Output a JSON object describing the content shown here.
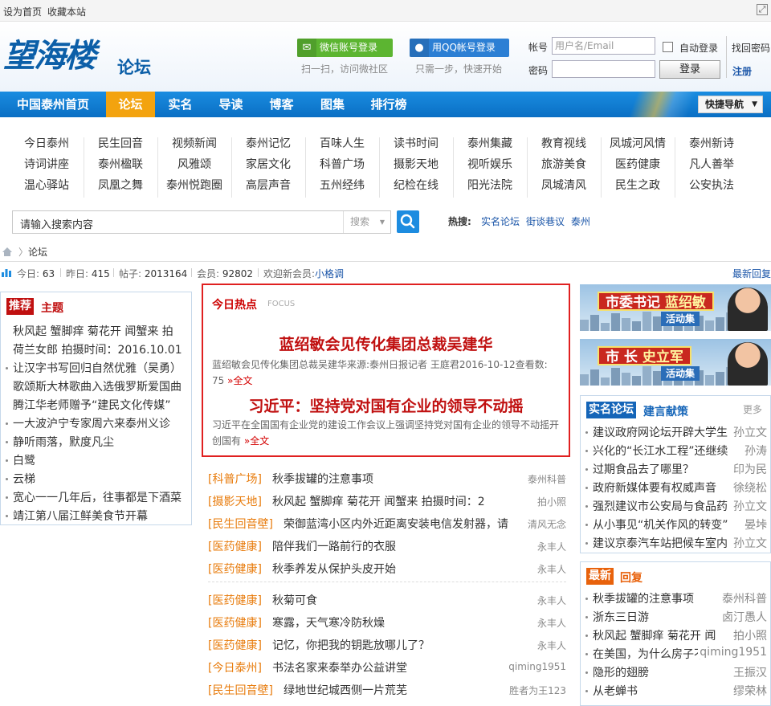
{
  "topbar": {
    "set_home": "设为首页",
    "bookmark": "收藏本站"
  },
  "header": {
    "logo_art": "望海楼",
    "logo_sub": "论坛",
    "wechat_login": "微信账号登录",
    "wechat_tip": "扫一扫，访问微社区",
    "qq_login": "用QQ帐号登录",
    "qq_tip": "只需一步，快速开始",
    "account_label": "帐号",
    "account_placeholder": "用户名/Email",
    "password_label": "密码",
    "auto_login": "自动登录",
    "login_button": "登录",
    "find_password": "找回密码",
    "register": "注册"
  },
  "nav": {
    "items": [
      "中国泰州首页",
      "论坛",
      "实名",
      "导读",
      "博客",
      "图集",
      "排行榜"
    ],
    "active_index": 1,
    "quick_nav": "快捷导航"
  },
  "categories": [
    [
      "今日泰州",
      "诗词讲座",
      "温心驿站"
    ],
    [
      "民生回音",
      "泰州楹联",
      "凤凰之舞"
    ],
    [
      "视频新闻",
      "风雅颂",
      "泰州悦跑圈"
    ],
    [
      "泰州记忆",
      "家居文化",
      "高层声音"
    ],
    [
      "百味人生",
      "科普广场",
      "五州经纬"
    ],
    [
      "读书时间",
      "摄影天地",
      "纪检在线"
    ],
    [
      "泰州集藏",
      "视听娱乐",
      "阳光法院"
    ],
    [
      "教育视线",
      "旅游美食",
      "凤城清风"
    ],
    [
      "凤城河风情",
      "医药健康",
      "民生之政"
    ],
    [
      "泰州新诗",
      "凡人善举",
      "公安执法"
    ]
  ],
  "search": {
    "placeholder": "请输入搜索内容",
    "type_label": "搜索",
    "hot_label": "热搜:",
    "hot_links": [
      "实名论坛",
      "街谈巷议",
      "泰州"
    ]
  },
  "breadcrumb": {
    "current": "论坛"
  },
  "stats": {
    "today_label": "今日:",
    "today": "63",
    "yesterday_label": "昨日:",
    "yesterday": "415",
    "posts_label": "帖子:",
    "posts": "2013164",
    "members_label": "会员:",
    "members": "92802",
    "welcome": "欢迎新会员:",
    "newest_member": "小格调",
    "latest_reply": "最新回复"
  },
  "recommend": {
    "tag": "推荐",
    "title": "主题",
    "items": [
      "秋风起 蟹脚痒 菊花开 闻蟹来 拍",
      "荷兰女郎 拍摄时间：2016.10.01",
      "让汉字书写回归自然优雅（吴勇）",
      "歌颂斯大林歌曲入选俄罗斯爱国曲",
      "腾江华老师赠予“建民文化传媒”",
      "一大波沪宁专家周六来泰州义诊",
      "静听雨落，默度凡尘",
      "白鹭",
      "云梯",
      "宽心一一几年后，往事都是下酒菜",
      "靖江第八届江鲜美食节开幕"
    ],
    "bulleted": [
      false,
      false,
      true,
      false,
      false,
      true,
      true,
      true,
      true,
      true,
      true
    ]
  },
  "focus": {
    "title": "今日热点",
    "subtitle": "FOCUS",
    "headline1": "蓝绍敏会见传化集团总裁吴建华",
    "desc1": "蓝绍敏会见传化集团总裁吴建华来源:泰州日报记者 王庭君2016-10-12查看数: 75",
    "more1": "全文",
    "headline2": "习近平：坚持党对国有企业的领导不动摇",
    "desc2": "习近平在全国国有企业党的建设工作会议上强调坚持党对国有企业的领导不动摇开创国有",
    "more2": "全文"
  },
  "threads": [
    {
      "cat": "[科普广场]",
      "title": "秋季拔罐的注意事项",
      "author": "泰州科普"
    },
    {
      "cat": "[摄影天地]",
      "title": "秋风起 蟹脚痒 菊花开 闻蟹来 拍摄时间：2",
      "author": "拍小照"
    },
    {
      "cat": "[民生回音壁]",
      "title": "荣御蓝湾小区内外近距离安装电信发射器，请",
      "author": "清风无念"
    },
    {
      "cat": "[医药健康]",
      "title": "陪伴我们一路前行的衣服",
      "author": "永丰人"
    },
    {
      "cat": "[医药健康]",
      "title": "秋季养发从保护头皮开始",
      "author": "永丰人"
    },
    {
      "cat": "[医药健康]",
      "title": "秋菊可食",
      "author": "永丰人"
    },
    {
      "cat": "[医药健康]",
      "title": "寒露，天气寒冷防秋燥",
      "author": "永丰人"
    },
    {
      "cat": "[医药健康]",
      "title": "记忆，你把我的钥匙放哪儿了？",
      "author": "永丰人"
    },
    {
      "cat": "[今日泰州]",
      "title": "书法名家来泰举办公益讲堂",
      "author": "qiming1951"
    },
    {
      "cat": "[民生回音壁]",
      "title": "绿地世纪城西侧一片荒芜",
      "author": "胜者为王123"
    }
  ],
  "banners": [
    {
      "role": "市委书记",
      "name": "蓝绍敏",
      "tag": "活动集"
    },
    {
      "role": "市 长",
      "name": "史立军",
      "tag": "活动集"
    }
  ],
  "realname": {
    "tag": "实名论坛",
    "title": "建言献策",
    "more": "更多",
    "items": [
      {
        "title": "建议政府网论坛开辟大学生",
        "author": "孙立文"
      },
      {
        "title": "兴化的“长江水工程”还继续",
        "author": "孙涛"
      },
      {
        "title": "过期食品去了哪里？",
        "author": "印为民"
      },
      {
        "title": "政府新媒体要有权威声音",
        "author": "徐绕松"
      },
      {
        "title": "强烈建议市公安局与食品药",
        "author": "孙立文"
      },
      {
        "title": "从小事见“机关作风的转变”",
        "author": "晏垰"
      },
      {
        "title": "建议京泰汽车站把候车室内",
        "author": "孙立文"
      }
    ]
  },
  "latest": {
    "tag": "最新",
    "title": "回复",
    "items": [
      {
        "title": "秋季拔罐的注意事项",
        "author": "泰州科普"
      },
      {
        "title": "浙东三日游",
        "author": "卤汀愚人"
      },
      {
        "title": "秋风起 蟹脚痒 菊花开 闻",
        "author": "拍小照"
      },
      {
        "title": "在美国，为什么房子不",
        "author": "qiming1951"
      },
      {
        "title": "隐形的翅膀",
        "author": "王振汉"
      },
      {
        "title": "从老蝉书",
        "author": "缪荣林"
      }
    ]
  },
  "colors": {
    "nav_blue": "#0a7fd6",
    "active_orange": "#f3a30f",
    "focus_red": "#e02020",
    "cat_orange": "#e87c0d",
    "link_blue": "#1a55a8",
    "tag_red": "#c01010",
    "tag_orange": "#e8620c",
    "tag_blue": "#1565b8"
  }
}
